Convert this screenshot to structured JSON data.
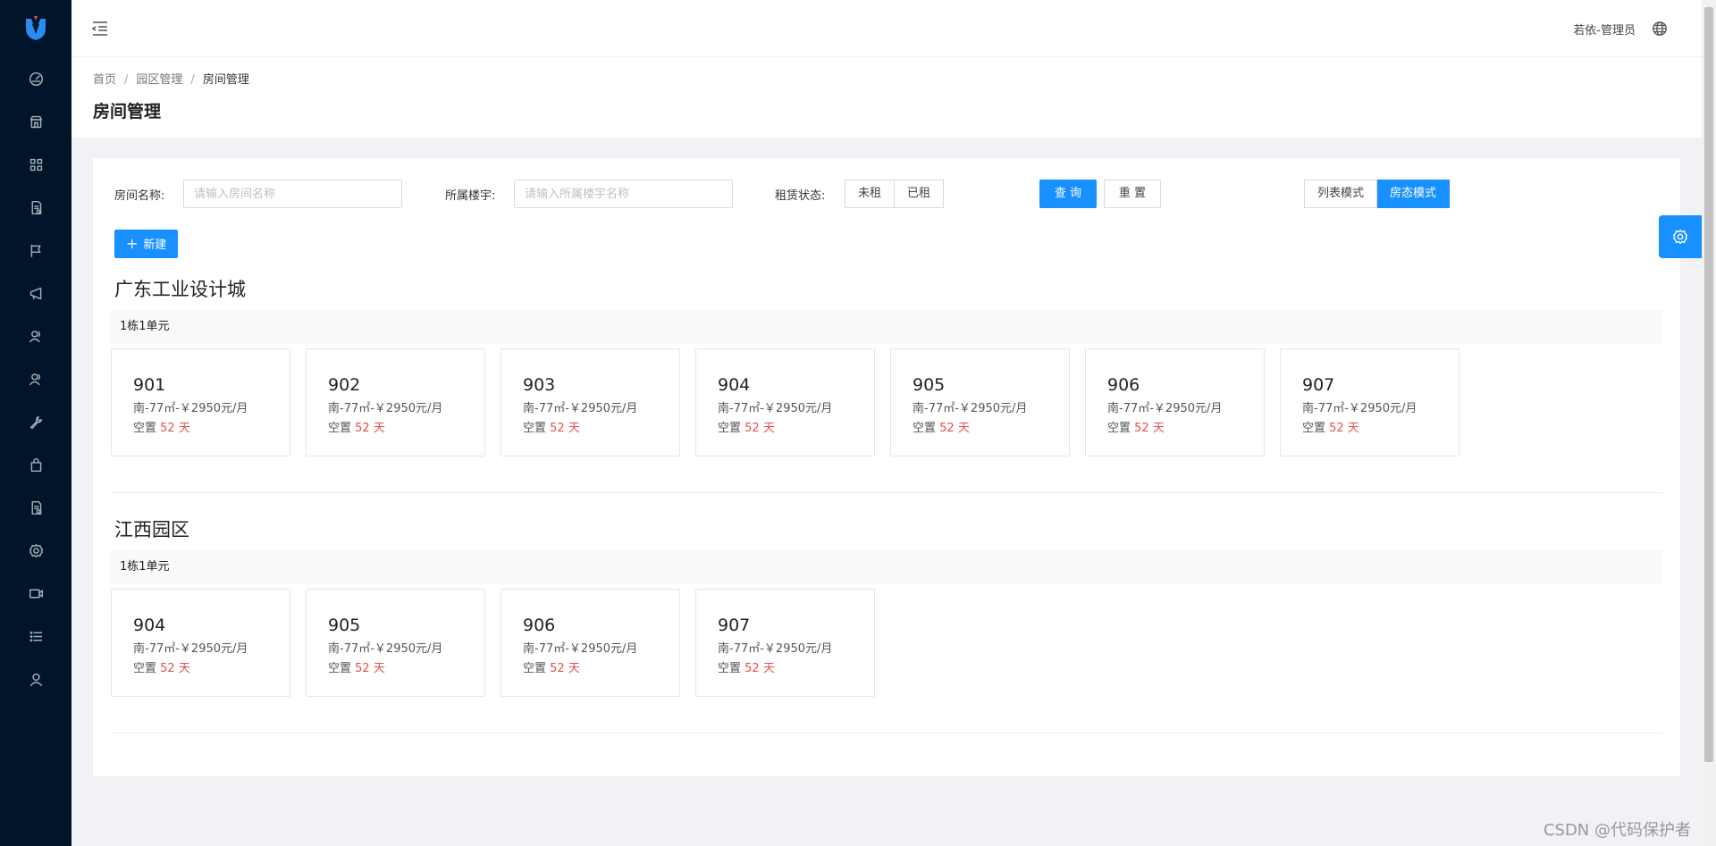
{
  "topbar": {
    "user_label": "若依-管理员"
  },
  "breadcrumb": {
    "items": [
      "首页",
      "园区管理",
      "房间管理"
    ]
  },
  "page": {
    "title": "房间管理"
  },
  "filters": {
    "room_name_label": "房间名称:",
    "room_name_placeholder": "请输入房间名称",
    "building_label": "所属楼宇:",
    "building_placeholder": "请输入所属楼宇名称",
    "rent_status_label": "租赁状态:",
    "rent_options": [
      "未租",
      "已租"
    ],
    "query_label": "查 询",
    "reset_label": "重 置",
    "view_modes": [
      "列表模式",
      "房态模式"
    ],
    "active_view": "房态模式",
    "new_label": "新建"
  },
  "parks": [
    {
      "name": "广东工业设计城",
      "building": "1栋1单元",
      "rooms": [
        {
          "number": "901",
          "info": "南-77㎡-￥2950元/月",
          "vacant": "空置",
          "days": "52 天"
        },
        {
          "number": "902",
          "info": "南-77㎡-￥2950元/月",
          "vacant": "空置",
          "days": "52 天"
        },
        {
          "number": "903",
          "info": "南-77㎡-￥2950元/月",
          "vacant": "空置",
          "days": "52 天"
        },
        {
          "number": "904",
          "info": "南-77㎡-￥2950元/月",
          "vacant": "空置",
          "days": "52 天"
        },
        {
          "number": "905",
          "info": "南-77㎡-￥2950元/月",
          "vacant": "空置",
          "days": "52 天"
        },
        {
          "number": "906",
          "info": "南-77㎡-￥2950元/月",
          "vacant": "空置",
          "days": "52 天"
        },
        {
          "number": "907",
          "info": "南-77㎡-￥2950元/月",
          "vacant": "空置",
          "days": "52 天"
        }
      ]
    },
    {
      "name": "江西园区",
      "building": "1栋1单元",
      "rooms": [
        {
          "number": "904",
          "info": "南-77㎡-￥2950元/月",
          "vacant": "空置",
          "days": "52 天"
        },
        {
          "number": "905",
          "info": "南-77㎡-￥2950元/月",
          "vacant": "空置",
          "days": "52 天"
        },
        {
          "number": "906",
          "info": "南-77㎡-￥2950元/月",
          "vacant": "空置",
          "days": "52 天"
        },
        {
          "number": "907",
          "info": "南-77㎡-￥2950元/月",
          "vacant": "空置",
          "days": "52 天"
        }
      ]
    }
  ],
  "sidebar": {
    "icons": [
      "dashboard-icon",
      "store-icon",
      "grid-icon",
      "document-icon",
      "flag-icon",
      "megaphone-icon",
      "user-group-icon",
      "user-group-icon",
      "wrench-icon",
      "bag-icon",
      "document-icon",
      "gear-icon",
      "video-icon",
      "list-icon",
      "user-icon"
    ]
  },
  "watermark": "CSDN @代码保护者",
  "colors": {
    "primary": "#1890ff",
    "sidebar_bg": "#001529",
    "days_red": "#e4504c"
  }
}
